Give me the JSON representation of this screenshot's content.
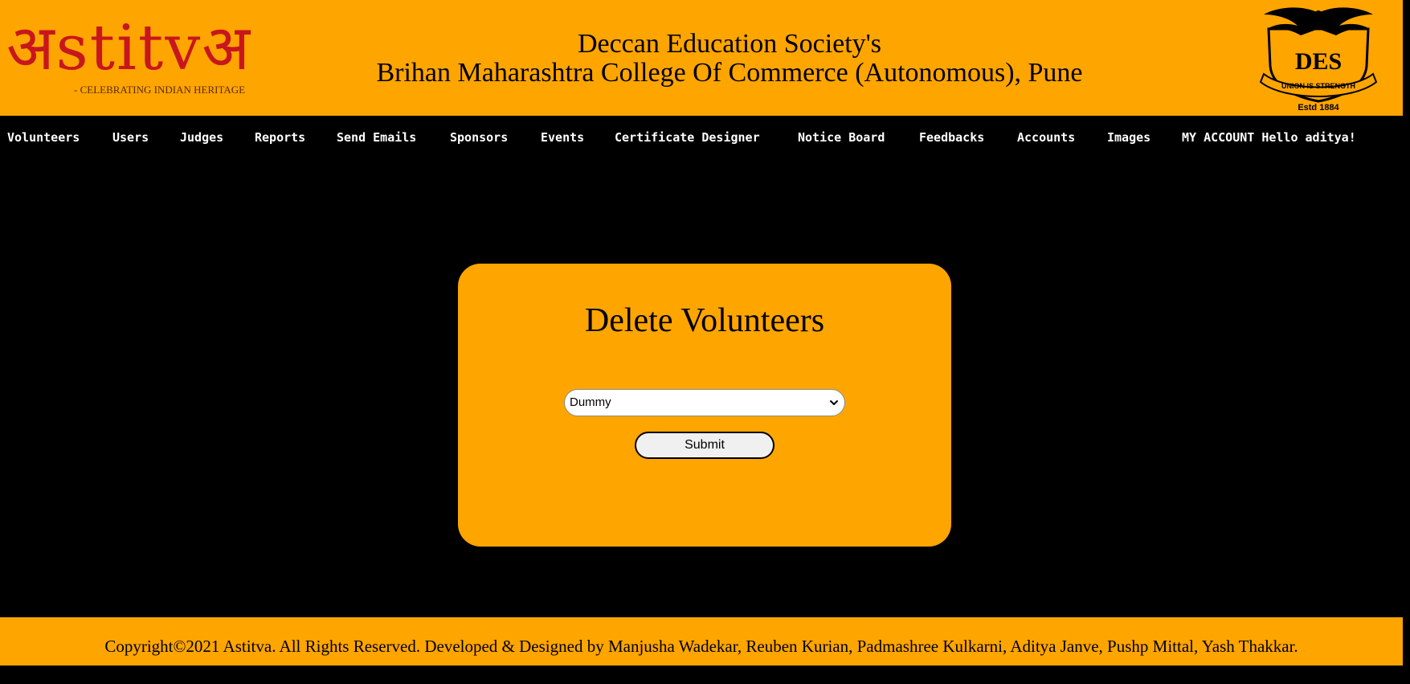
{
  "header": {
    "logo": {
      "wordmark": "अstitvअ",
      "tagline": "- CELEBRATING INDIAN HERITAGE"
    },
    "title_line1": "Deccan Education Society's",
    "title_line2": "Brihan Maharashtra College Of Commerce (Autonomous), Pune",
    "emblem": {
      "motto": "UNION IS STRENGTH",
      "monogram": "DES",
      "established": "Estd 1884"
    }
  },
  "nav": {
    "items": [
      {
        "label": "Volunteers"
      },
      {
        "label": "Users"
      },
      {
        "label": "Judges"
      },
      {
        "label": "Reports"
      },
      {
        "label": "Send Emails"
      },
      {
        "label": "Sponsors"
      },
      {
        "label": "Events"
      },
      {
        "label": "Certificate Designer"
      },
      {
        "label": "Notice Board"
      },
      {
        "label": "Feedbacks"
      },
      {
        "label": "Accounts"
      },
      {
        "label": "Images"
      },
      {
        "label": "MY ACCOUNT Hello aditya!"
      }
    ]
  },
  "form": {
    "title": "Delete Volunteers",
    "select_value": "Dummy",
    "submit_label": "Submit"
  },
  "footer": {
    "text": "Copyright©2021 Astitva. All Rights Reserved. Developed & Designed by Manjusha Wadekar, Reuben Kurian, Padmashree Kulkarni, Aditya Janve, Pushp Mittal, Yash Thakkar."
  },
  "colors": {
    "accent": "#FFA500",
    "background": "#000000",
    "logo_red": "#C8161D"
  },
  "icons": [
    "chevron-down-icon",
    "college-emblem-icon"
  ]
}
